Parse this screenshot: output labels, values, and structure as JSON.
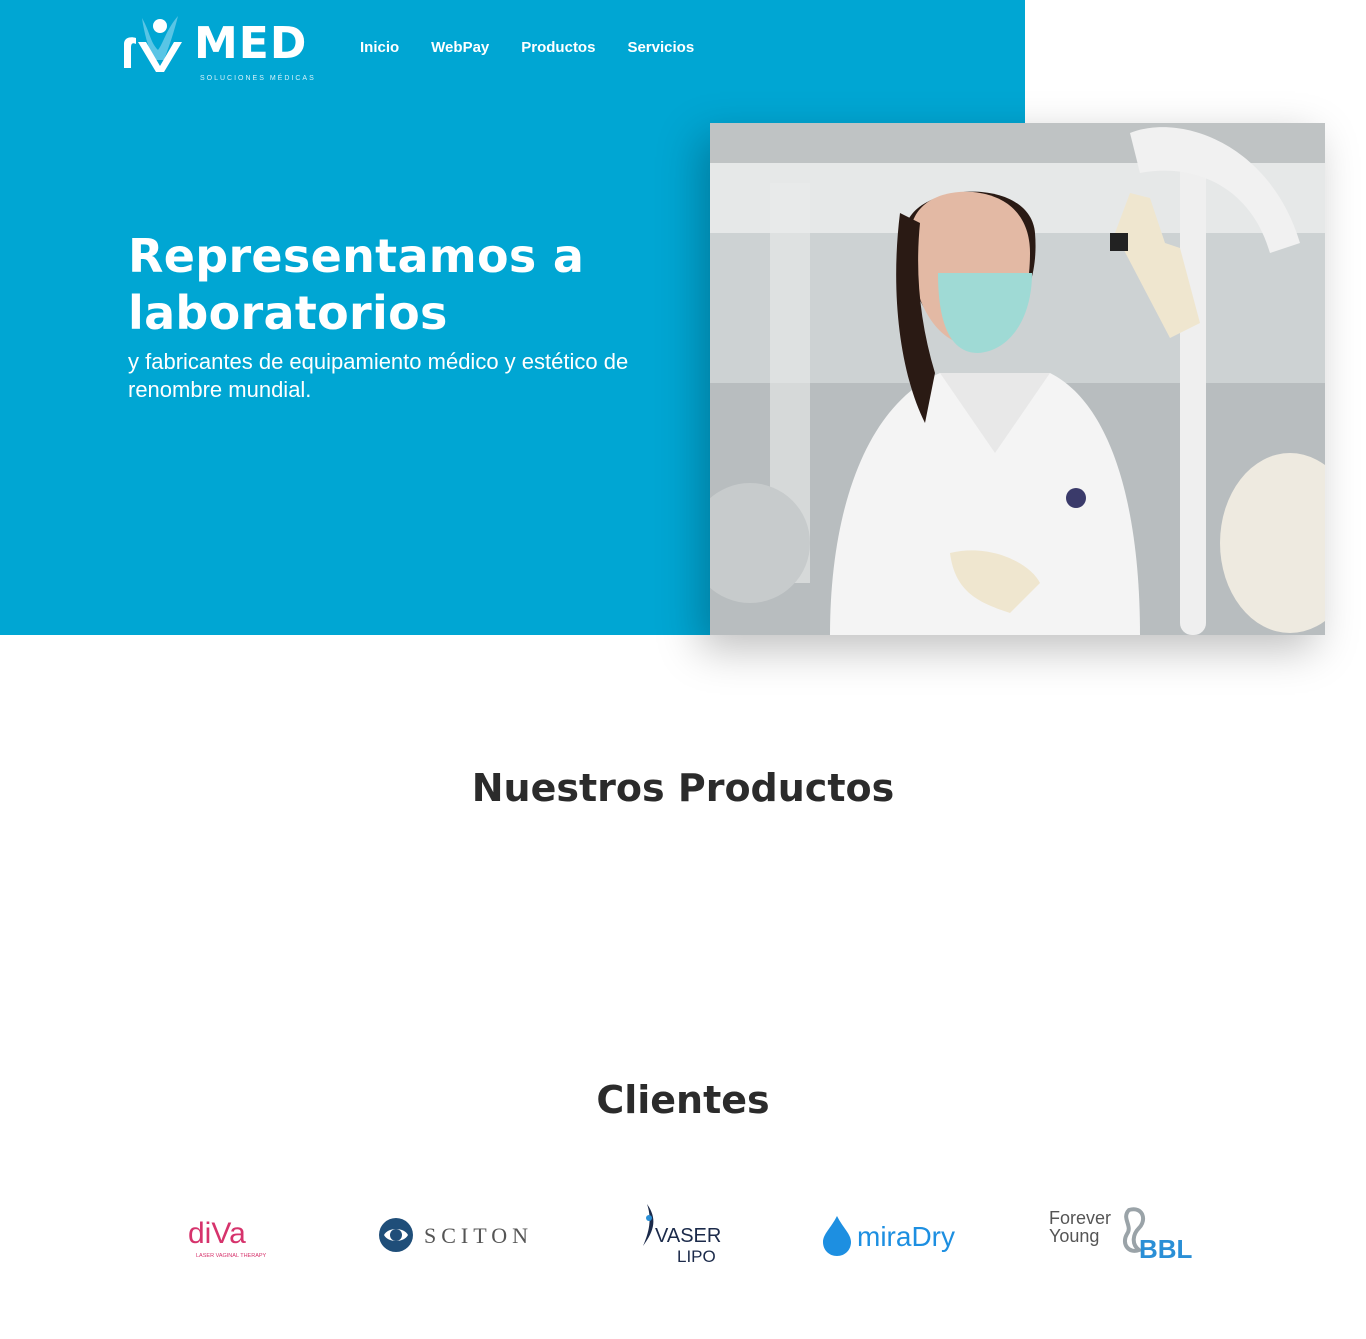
{
  "brand": {
    "logo_text": "MED",
    "logo_subtitle": "SOLUCIONES MÉDICAS"
  },
  "nav": {
    "items": [
      "Inicio",
      "WebPay",
      "Productos",
      "Servicios"
    ]
  },
  "hero": {
    "title": "Representamos a laboratorios",
    "subtitle": "y fabricantes de equipamiento médico y estético de renombre mundial."
  },
  "products": {
    "title": "Nuestros Productos"
  },
  "clients": {
    "title": "Clientes",
    "logos": [
      {
        "name": "diVa",
        "tagline": "LASER VAGINAL THERAPY"
      },
      {
        "name": "SCITON"
      },
      {
        "name": "VASER",
        "sub": "LIPO"
      },
      {
        "name": "miraDry"
      },
      {
        "name": "BBL",
        "prefix_top": "Forever",
        "prefix_bottom": "Young"
      }
    ]
  },
  "colors": {
    "primary": "#00a6d3",
    "heading": "#2b2b2b",
    "diva": "#d6336c",
    "sciton": "#1f4e79",
    "vaser": "#1b2a4a",
    "miradry": "#1d8fe1",
    "bbl": "#2a8fd6"
  }
}
